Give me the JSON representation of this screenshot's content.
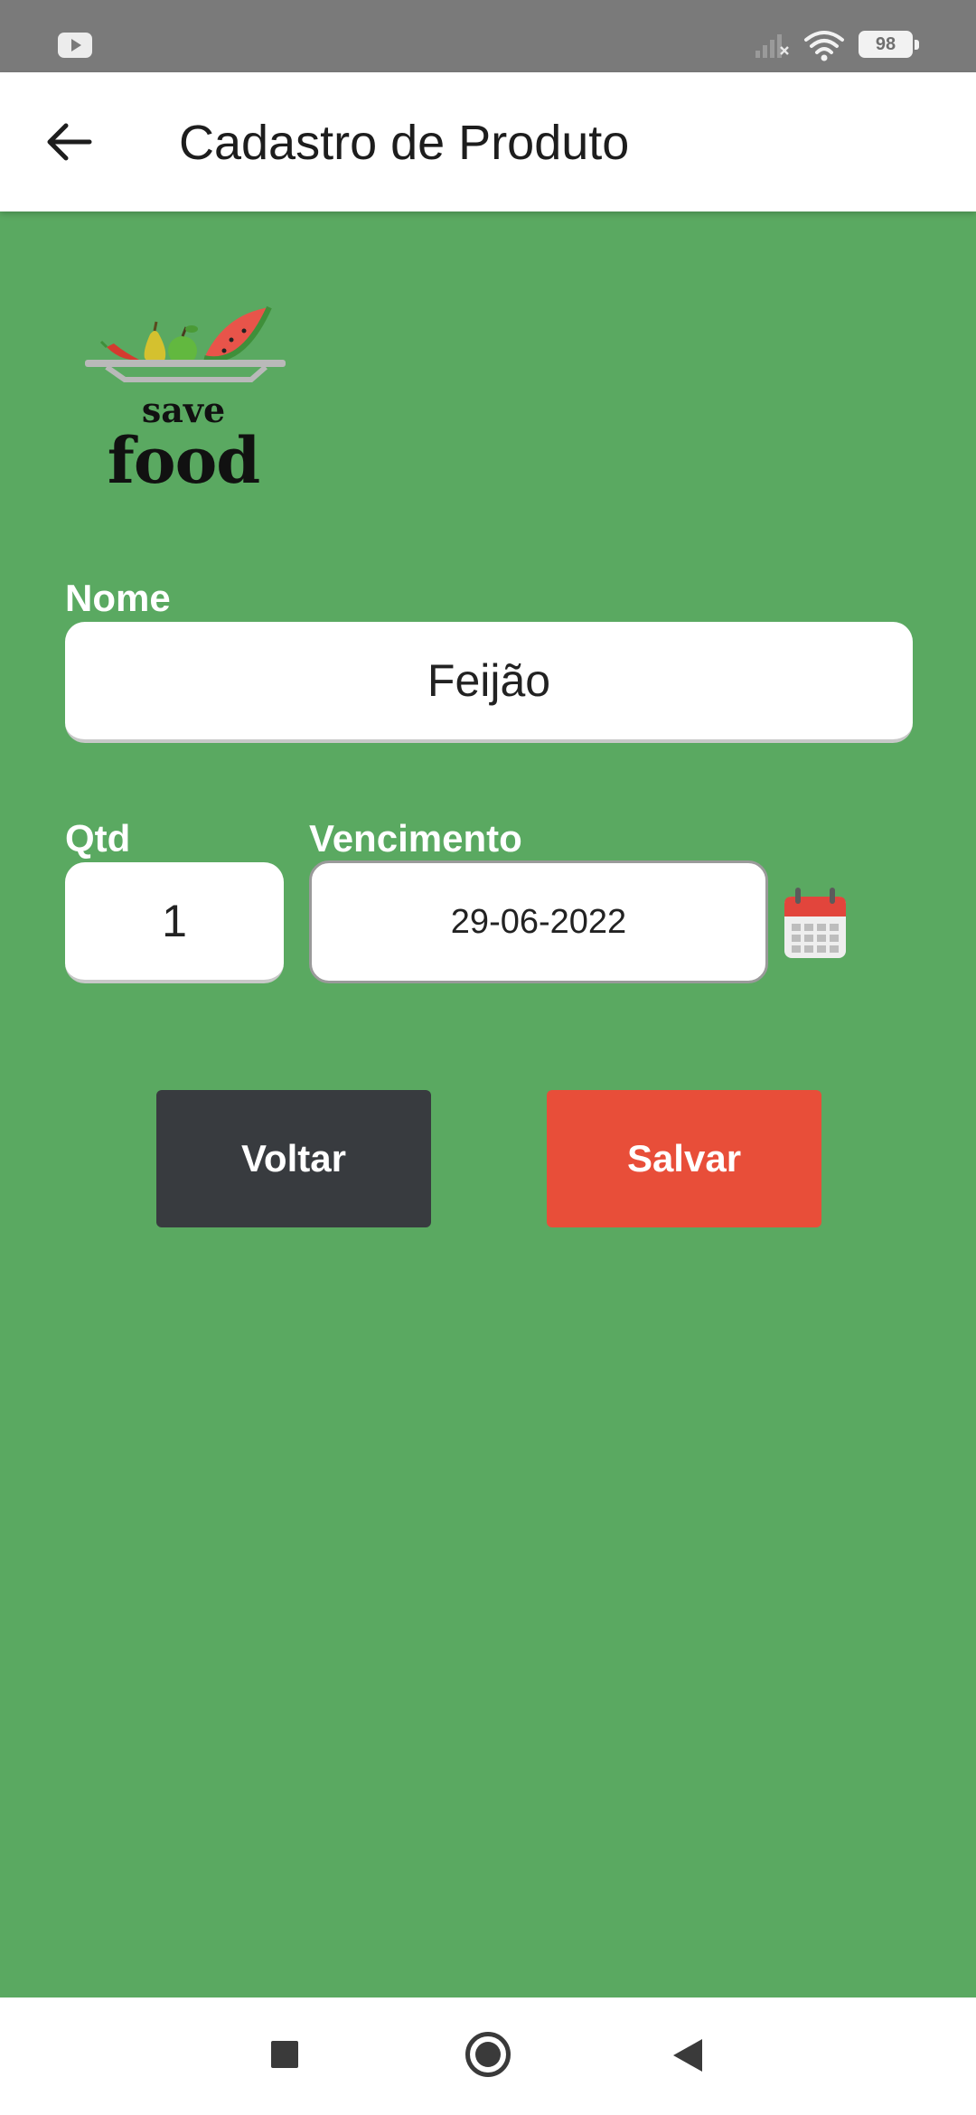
{
  "status_bar": {
    "battery_level": "98",
    "icons": [
      "youtube-notification-icon",
      "signal-icon",
      "wifi-icon",
      "battery-icon"
    ]
  },
  "app_bar": {
    "title": "Cadastro de Produto",
    "back_icon": "arrow-left-icon"
  },
  "logo": {
    "line1": "save",
    "line2": "food"
  },
  "form": {
    "nome_label": "Nome",
    "nome_value": "Feijão",
    "qtd_label": "Qtd",
    "qtd_value": "1",
    "vencimento_label": "Vencimento",
    "vencimento_value": "29-06-2022",
    "calendar_icon": "calendar-icon"
  },
  "buttons": {
    "voltar": "Voltar",
    "salvar": "Salvar"
  },
  "colors": {
    "background": "#5aa961",
    "voltar_button": "#383b3f",
    "salvar_button": "#e84e39"
  },
  "nav_bar": {
    "icons": [
      "recents-icon",
      "home-icon",
      "back-icon"
    ]
  }
}
